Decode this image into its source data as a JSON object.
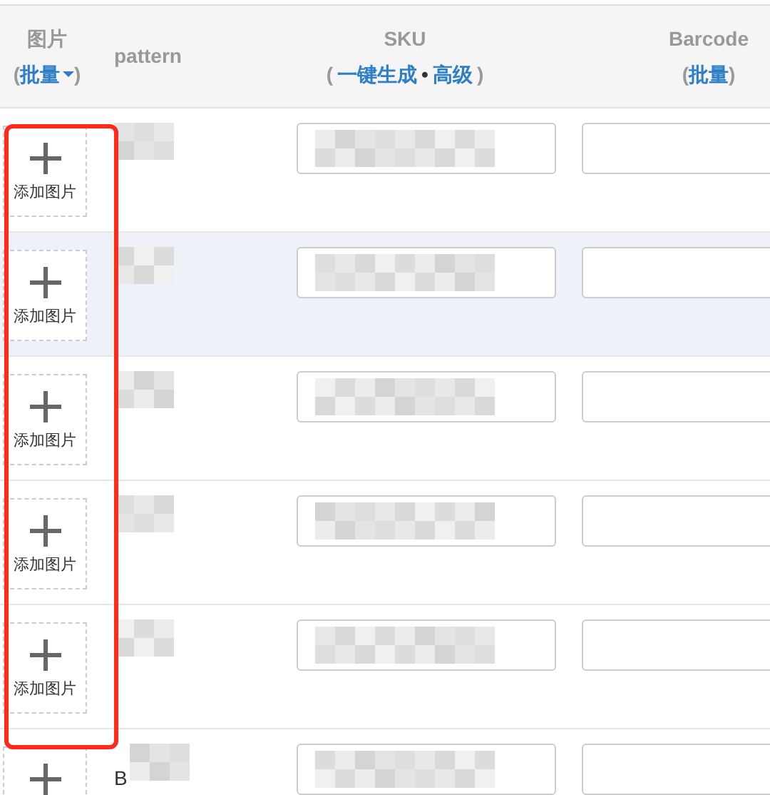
{
  "header": {
    "image_title": "图片",
    "image_action": "批量",
    "pattern_title": "pattern",
    "sku_title": "SKU",
    "sku_actions": [
      "一键生成",
      "高级"
    ],
    "separator": "•",
    "barcode_title": "Barcode",
    "barcode_action": "批量",
    "paren_open": "(",
    "paren_close": ")"
  },
  "rows": [
    {
      "selected": false,
      "image_label": "添加图片"
    },
    {
      "selected": true,
      "image_label": "添加图片"
    },
    {
      "selected": false,
      "image_label": "添加图片"
    },
    {
      "selected": false,
      "image_label": "添加图片"
    },
    {
      "selected": false,
      "image_label": "添加图片"
    },
    {
      "selected": false,
      "pattern": "B"
    }
  ]
}
